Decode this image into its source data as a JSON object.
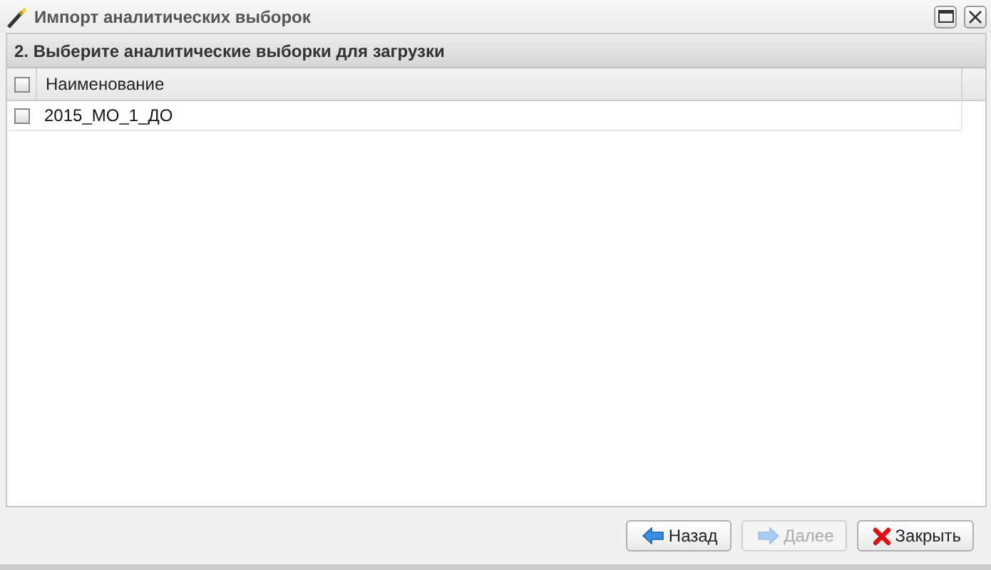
{
  "window": {
    "title": "Импорт аналитических выборок"
  },
  "panel": {
    "title": "2. Выберите аналитические выборки для загрузки"
  },
  "table": {
    "select_all": {
      "checked": false
    },
    "columns": [
      "Наименование"
    ],
    "rows": [
      {
        "name": "2015_МО_1_ДО",
        "checked": false
      }
    ]
  },
  "buttons": [
    {
      "kind": "back",
      "label": "Назад",
      "disabled": false
    },
    {
      "kind": "next",
      "label": "Далее",
      "disabled": true
    },
    {
      "kind": "close",
      "label": "Закрыть",
      "disabled": false
    }
  ]
}
